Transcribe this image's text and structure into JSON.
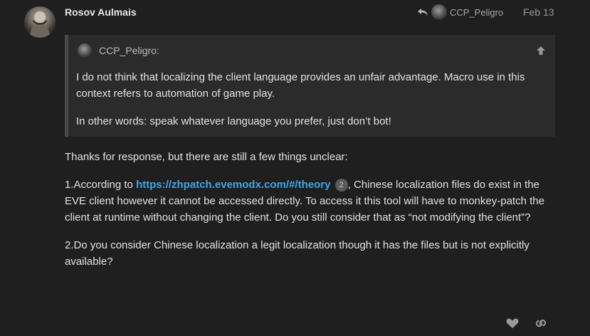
{
  "post": {
    "username": "Rosov Aulmais",
    "reply_to_user": "CCP_Peligro",
    "date": "Feb 13",
    "quote": {
      "author": "CCP_Peligro:",
      "paragraphs": [
        "I do not think that localizing the client language provides an unfair advantage. Macro use in this context refers to automation of game play.",
        "In other words: speak whatever language you prefer, just don’t bot!"
      ]
    },
    "content": {
      "p1": "Thanks for response, but there are still a few things unclear:",
      "p2_prefix": "1.According to ",
      "p2_link": "https://zhpatch.evemodx.com/#/theory",
      "p2_link_clicks": "2",
      "p2_suffix": ", Chinese localization files do exist in the EVE client however it cannot be accessed directly. To access it this tool will have to monkey-patch the client at runtime without changing the client. Do you still consider that as “not modifying the client”?",
      "p3": "2.Do you consider Chinese localization a legit localization though it has the files but is not explicitly available?"
    }
  },
  "icons": {
    "avatar": "avatar",
    "reply": "reply-arrow-icon",
    "quote_jump": "arrow-up-icon",
    "like": "heart-icon",
    "share": "link-icon"
  },
  "colors": {
    "background": "#1f1f1f",
    "quote_background": "#2b2b2b",
    "link": "#3ea7e8",
    "text": "#e2e2e2"
  }
}
